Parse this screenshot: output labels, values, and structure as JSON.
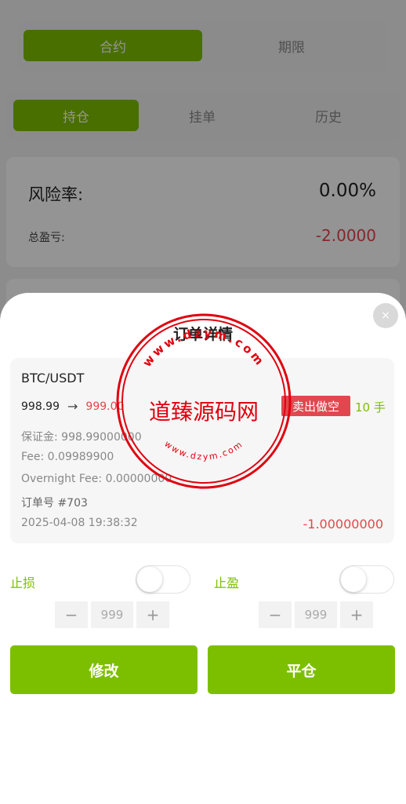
{
  "top_segment": {
    "contract": "合约",
    "term": "期限"
  },
  "position_tabs": {
    "holdings": "持仓",
    "orders": "挂单",
    "history": "历史"
  },
  "summary": {
    "risk_label": "风险率:",
    "risk_value": "0.00%",
    "pnl_label": "总盈亏:",
    "pnl_value": "-2.0000"
  },
  "sheet": {
    "close_icon": "×",
    "title": "订单详情",
    "order": {
      "symbol": "BTC/USDT",
      "open_price": "998.99",
      "arrow": "→",
      "current_price": "999.00",
      "side": "卖出做空",
      "lots": "10 手",
      "margin": "保证金: 998.99000000",
      "fee": "Fee: 0.09989900",
      "overnight_fee": "Overnight Fee: 0.00000000",
      "order_no": "订单号 #703",
      "time": "2025-04-08 19:38:32",
      "amount": "-1.00000000"
    },
    "stop_loss": {
      "label": "止损",
      "enabled": false,
      "minus": "−",
      "value": "999",
      "plus": "+"
    },
    "take_profit": {
      "label": "止盈",
      "enabled": false,
      "minus": "−",
      "value": "999",
      "plus": "+"
    },
    "modify_button": "修改",
    "close_position_button": "平仓"
  },
  "watermark": {
    "top_text": "www.dzym.com",
    "center_text": "道臻源码网",
    "bottom_text": "www.dzym.com"
  },
  "colors": {
    "accent_green": "#7cbf00",
    "sell_red": "#e2474f"
  },
  "icons": {
    "close": "close-icon",
    "arrow": "arrow-right-icon",
    "minus": "minus-icon",
    "plus": "plus-icon"
  }
}
